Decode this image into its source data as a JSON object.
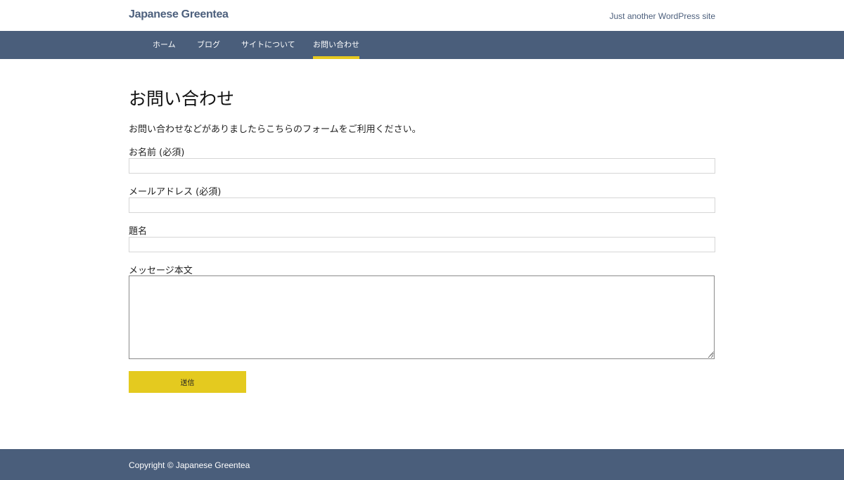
{
  "header": {
    "site_title": "Japanese Greentea",
    "tagline": "Just another WordPress site"
  },
  "nav": {
    "items": [
      {
        "label": "ホーム"
      },
      {
        "label": "ブログ"
      },
      {
        "label": "サイトについて"
      },
      {
        "label": "お問い合わせ",
        "active": true
      }
    ]
  },
  "main": {
    "title": "お問い合わせ",
    "intro": "お問い合わせなどがありましたらこちらのフォームをご利用ください。",
    "fields": {
      "name_label": "お名前 (必須)",
      "email_label": "メールアドレス (必須)",
      "subject_label": "題名",
      "message_label": "メッセージ本文"
    },
    "submit_label": "送信"
  },
  "footer": {
    "copyright": "Copyright © Japanese Greentea"
  },
  "colors": {
    "nav_background": "#4a5e7b",
    "accent": "#e4ca1f",
    "brand_text": "#4c5f7c"
  }
}
